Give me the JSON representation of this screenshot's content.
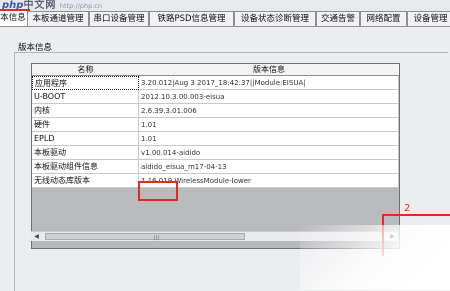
{
  "brand": {
    "logo_text": "php",
    "logo_cn": "中文网",
    "logo_sub": "http://php.cn"
  },
  "tabs": [
    {
      "label": "本信息",
      "active": true
    },
    {
      "label": "本板通道管理"
    },
    {
      "label": "串口设备管理"
    },
    {
      "label": "铁路PSD信息管理"
    },
    {
      "label": "设备状态诊断管理"
    },
    {
      "label": "交通告警"
    },
    {
      "label": "网络配置"
    },
    {
      "label": "设备管理"
    }
  ],
  "section_title": "版本信息",
  "table": {
    "headers": {
      "name": "名称",
      "version": "版本信息"
    },
    "rows": [
      {
        "name": "应用程序",
        "value": "3.20.012|Aug  3 2017_18:42:37||Module:EISUA|"
      },
      {
        "name": "U-BOOT",
        "value": "2012.10.3.00.003-eisua"
      },
      {
        "name": "内核",
        "value": "2.6.39.3.01.006"
      },
      {
        "name": "硬件",
        "value": "1.01"
      },
      {
        "name": "EPLD",
        "value": "1.01"
      },
      {
        "name": "本板驱动",
        "value": "v1.00.014-aidido"
      },
      {
        "name": "本板驱动组件信息",
        "value": "aidido_eisua_m17-04-13"
      },
      {
        "name": "无线动态库版本",
        "value": "1.16.019 WirelessModule-Iower"
      }
    ]
  },
  "annotation": {
    "number": "2"
  }
}
